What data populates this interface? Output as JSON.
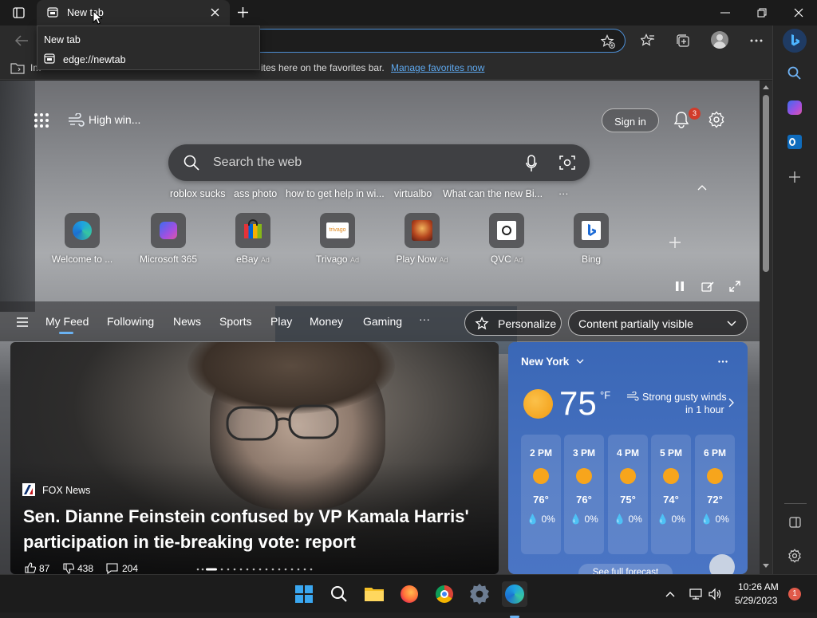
{
  "tab": {
    "title": "New tab"
  },
  "tooltip": {
    "title": "New tab",
    "url": "edge://newtab"
  },
  "favorites_bar": {
    "prefix": "Im",
    "text": "ites here on the favorites bar.",
    "link": "Manage favorites now"
  },
  "header": {
    "weather_short": "High win...",
    "sign_in": "Sign in",
    "notification_count": "3"
  },
  "search": {
    "placeholder": "Search the web"
  },
  "trending": [
    "roblox sucks",
    "ass photo",
    "how to get help in wi...",
    "virtualbo",
    "What can the new Bi...",
    "···"
  ],
  "quick_links": [
    {
      "label": "Welcome to ...",
      "ad": ""
    },
    {
      "label": "Microsoft 365",
      "ad": ""
    },
    {
      "label": "eBay",
      "ad": "Ad"
    },
    {
      "label": "Trivago",
      "ad": "Ad"
    },
    {
      "label": "Play Now",
      "ad": "Ad"
    },
    {
      "label": "QVC",
      "ad": "Ad"
    },
    {
      "label": "Bing",
      "ad": ""
    }
  ],
  "feed_nav": {
    "items": [
      "My Feed",
      "Following",
      "News",
      "Sports",
      "Play",
      "Money",
      "Gaming"
    ],
    "more": "···",
    "personalize": "Personalize",
    "content_select": "Content partially visible"
  },
  "news": {
    "source": "FOX News",
    "headline": "Sen. Dianne Feinstein confused by VP Kamala Harris' participation in tie-breaking vote: report",
    "likes": "87",
    "dislikes": "438",
    "comments": "204"
  },
  "weather": {
    "location": "New York",
    "temp": "75",
    "unit": "°F",
    "alert_line1": "Strong gusty winds",
    "alert_line2": "in 1 hour",
    "hourly": [
      {
        "time": "2 PM",
        "temp": "76°",
        "precip": "0%"
      },
      {
        "time": "3 PM",
        "temp": "76°",
        "precip": "0%"
      },
      {
        "time": "4 PM",
        "temp": "75°",
        "precip": "0%"
      },
      {
        "time": "5 PM",
        "temp": "74°",
        "precip": "0%"
      },
      {
        "time": "6 PM",
        "temp": "72°",
        "precip": "0%"
      }
    ],
    "full_forecast": "See full forecast"
  },
  "taskbar": {
    "time": "10:26 AM",
    "date": "5/29/2023",
    "notifications": "1"
  }
}
